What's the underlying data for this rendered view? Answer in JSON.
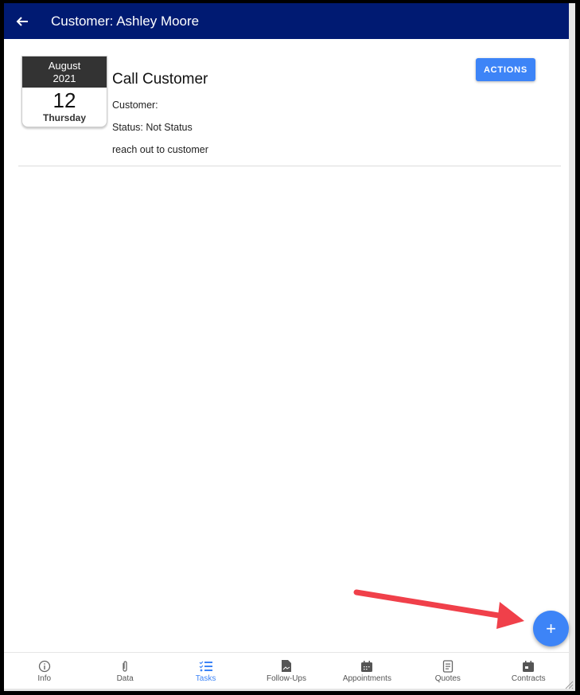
{
  "header": {
    "title": "Customer: Ashley Moore",
    "back_icon": "arrow-left-icon"
  },
  "task": {
    "calendar": {
      "month": "August",
      "year": "2021",
      "day": "12",
      "weekday": "Thursday"
    },
    "title": "Call Customer",
    "customer_line": "Customer:",
    "status_line": "Status: Not Status",
    "description": "reach out to customer",
    "actions_label": "ACTIONS"
  },
  "fab": {
    "icon": "plus-icon",
    "symbol": "+"
  },
  "colors": {
    "appbar": "#001a72",
    "accent": "#3d84f7",
    "annotation_arrow": "#f0404a"
  },
  "bottom_nav": [
    {
      "label": "Info",
      "icon": "info-icon",
      "active": false
    },
    {
      "label": "Data",
      "icon": "paperclip-icon",
      "active": false
    },
    {
      "label": "Tasks",
      "icon": "checklist-icon",
      "active": true
    },
    {
      "label": "Follow-Ups",
      "icon": "document-icon",
      "active": false
    },
    {
      "label": "Appointments",
      "icon": "calendar-icon",
      "active": false
    },
    {
      "label": "Quotes",
      "icon": "note-icon",
      "active": false
    },
    {
      "label": "Contracts",
      "icon": "card-icon",
      "active": false
    }
  ]
}
